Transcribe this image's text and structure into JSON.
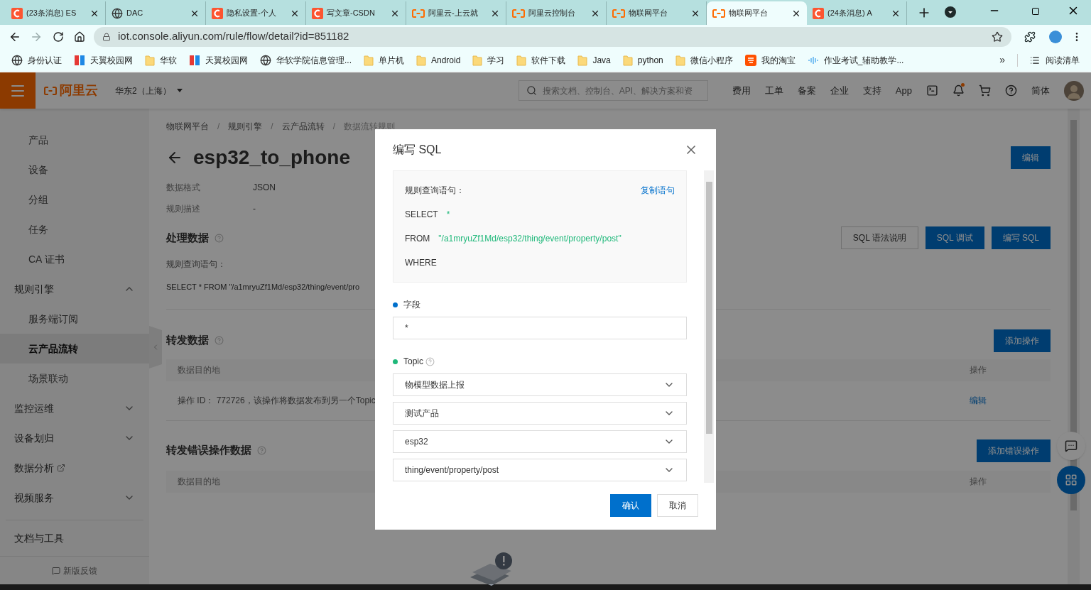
{
  "browser": {
    "tabs": [
      {
        "title": "(23条消息) ES",
        "kind": "csdn",
        "selected": false
      },
      {
        "title": "DAC",
        "kind": "globe",
        "selected": false
      },
      {
        "title": "隐私设置-个人",
        "kind": "csdn",
        "selected": false
      },
      {
        "title": "写文章-CSDN",
        "kind": "csdn",
        "selected": false
      },
      {
        "title": "阿里云-上云就",
        "kind": "aliyun",
        "selected": false
      },
      {
        "title": "阿里云控制台",
        "kind": "aliyun",
        "selected": false
      },
      {
        "title": "物联网平台",
        "kind": "aliyun",
        "selected": false
      },
      {
        "title": "物联网平台",
        "kind": "aliyun",
        "selected": true
      },
      {
        "title": "(24条消息) A",
        "kind": "csdn",
        "selected": false
      }
    ],
    "url": "iot.console.aliyun.com/rule/flow/detail?id=851182",
    "bookmarks": [
      {
        "label": "身份认证",
        "kind": "globe"
      },
      {
        "label": "天翼校园网",
        "kind": "bars"
      },
      {
        "label": "华软",
        "kind": "folder"
      },
      {
        "label": "天翼校园网",
        "kind": "bars"
      },
      {
        "label": "华软学院信息管理...",
        "kind": "globe"
      },
      {
        "label": "单片机",
        "kind": "folder"
      },
      {
        "label": "Android",
        "kind": "folder"
      },
      {
        "label": "学习",
        "kind": "folder"
      },
      {
        "label": "软件下载",
        "kind": "folder"
      },
      {
        "label": "Java",
        "kind": "folder"
      },
      {
        "label": "python",
        "kind": "folder"
      },
      {
        "label": "微信小程序",
        "kind": "folder"
      },
      {
        "label": "我的淘宝",
        "kind": "taobao"
      },
      {
        "label": "作业考试_辅助教学...",
        "kind": "wave"
      }
    ],
    "bookmarks_more": "»",
    "reading_list": "阅读清单"
  },
  "header": {
    "logo": "阿里云",
    "region": "华东2（上海）",
    "search_placeholder": "搜索文档、控制台、API、解决方案和资",
    "links": [
      "费用",
      "工单",
      "备案",
      "企业",
      "支持",
      "App"
    ],
    "language": "简体",
    "notification_dot": true
  },
  "sidebar": {
    "sections": [
      {
        "children": [
          {
            "label": "产品",
            "selected": false
          },
          {
            "label": "设备",
            "selected": false
          },
          {
            "label": "分组",
            "selected": false
          },
          {
            "label": "任务",
            "selected": false
          },
          {
            "label": "CA 证书",
            "selected": false
          }
        ]
      },
      {
        "label": "规则引擎",
        "kind": "group",
        "expanded": true,
        "children": [
          {
            "label": "服务端订阅",
            "selected": false
          },
          {
            "label": "云产品流转",
            "selected": true
          },
          {
            "label": "场景联动",
            "selected": false
          }
        ]
      },
      {
        "label": "监控运维",
        "kind": "group",
        "expanded": false
      },
      {
        "label": "设备划归",
        "kind": "group",
        "expanded": false
      },
      {
        "label": "数据分析",
        "kind": "external"
      },
      {
        "label": "视频服务",
        "kind": "group",
        "expanded": false
      },
      {
        "label": "文档与工具",
        "kind": "plain"
      }
    ],
    "feedback": "新版反馈"
  },
  "main": {
    "breadcrumb": [
      {
        "label": "物联网平台",
        "kind": "link"
      },
      {
        "label": "/",
        "kind": "separator"
      },
      {
        "label": "规则引擎",
        "kind": "link"
      },
      {
        "label": "/",
        "kind": "separator"
      },
      {
        "label": "云产品流转",
        "kind": "link"
      },
      {
        "label": "/",
        "kind": "separator"
      },
      {
        "label": "数据流转规则",
        "kind": "current"
      }
    ],
    "title": "esp32_to_phone",
    "edit_button": "编辑",
    "meta": [
      {
        "label": "数据格式",
        "value": "JSON"
      },
      {
        "label": "规则描述",
        "value": "-"
      }
    ],
    "process": {
      "title": "处理数据",
      "buttons": [
        {
          "label": "SQL 语法说明",
          "primary": false
        },
        {
          "label": "SQL 调试",
          "primary": true
        },
        {
          "label": "编写 SQL",
          "primary": true
        }
      ],
      "query_label": "规则查询语句：",
      "query": "SELECT * FROM \"/a1mryuZf1Md/esp32/thing/event/pro"
    },
    "forward": {
      "title": "转发数据",
      "button": "添加操作",
      "columns": [
        "数据目的地",
        "操作"
      ],
      "rows": [
        {
          "text": "操作 ID： 772726，该操作将数据发布到另一个Topic",
          "action": "编辑"
        }
      ]
    },
    "error": {
      "title": "转发错误操作数据",
      "button": "添加错误操作",
      "columns": [
        "数据目的地",
        "操作"
      ]
    }
  },
  "dialog": {
    "title": "编写 SQL",
    "query_label": "规则查询语句：",
    "copy_link": "复制语句",
    "lines": [
      {
        "keyword": "SELECT",
        "value": "*"
      },
      {
        "keyword": "FROM",
        "value": "\"/a1mryuZf1Md/esp32/thing/event/property/post\""
      },
      {
        "keyword": "WHERE"
      }
    ],
    "fields": [
      {
        "label": "字段",
        "color": "#0070cc",
        "help": false,
        "controls": [
          {
            "kind": "input",
            "value": "*"
          }
        ]
      },
      {
        "label": "Topic",
        "color": "#1fb87a",
        "help": true,
        "controls": [
          {
            "kind": "select",
            "value": "物模型数据上报"
          },
          {
            "kind": "select",
            "value": "测试产品"
          },
          {
            "kind": "select",
            "value": "esp32"
          },
          {
            "kind": "select",
            "value": "thing/event/property/post"
          }
        ]
      }
    ],
    "buttons": [
      {
        "label": "确认",
        "primary": true
      },
      {
        "label": "取消",
        "primary": false
      }
    ]
  }
}
